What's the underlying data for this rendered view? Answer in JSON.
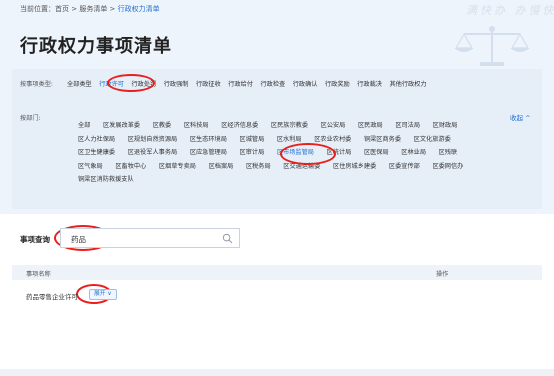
{
  "breadcrumb": {
    "prefix": "当前位置：",
    "home": "首页",
    "sep1": " > ",
    "services": "服务清单",
    "sep2": " > ",
    "current": "行政权力清单"
  },
  "slogan": "满快办 办慢快",
  "page_title": "行政权力事项清单",
  "filters": {
    "type_label": "按事项类型:",
    "types": [
      {
        "label": "全部类型",
        "active": false
      },
      {
        "label": "行政许可",
        "active": true
      },
      {
        "label": "行政处罚",
        "active": false
      },
      {
        "label": "行政强制",
        "active": false
      },
      {
        "label": "行政征收",
        "active": false
      },
      {
        "label": "行政给付",
        "active": false
      },
      {
        "label": "行政检查",
        "active": false
      },
      {
        "label": "行政确认",
        "active": false
      },
      {
        "label": "行政奖励",
        "active": false
      },
      {
        "label": "行政裁决",
        "active": false
      },
      {
        "label": "其他行政权力",
        "active": false
      }
    ],
    "dept_label": "按部门:",
    "collapse_label": "收起 ^",
    "dept_rows": [
      [
        "全部",
        "区发展改革委",
        "区教委",
        "区科技局",
        "区经济信息委",
        "区民族宗教委",
        "区公安局",
        "区民政局",
        "区司法局",
        "区财政局"
      ],
      [
        "区人力社保局",
        "区规划自然资源局",
        "区生态环境局",
        "区城管局",
        "区水利局",
        "区农业农村委",
        "铜梁区商务委",
        "区文化旅游委"
      ],
      [
        "区卫生健康委",
        "区退役军人事务局",
        "区应急管理局",
        "区审计局",
        "区市场监管局",
        "区统计局",
        "区医保局",
        "区林业局",
        "区残联"
      ],
      [
        "区气象局",
        "区畜牧中心",
        "区烟草专卖局",
        "区档案局",
        "区税务局",
        "区交通运输委",
        "区住房城乡建委",
        "区委宣传部",
        "区委网信办"
      ],
      [
        "铜梁区消防救援支队"
      ]
    ],
    "active_dept": "区市场监管局"
  },
  "search": {
    "label": "事项查询",
    "value": "药品",
    "icon": "search-icon"
  },
  "table": {
    "col_name": "事项名称",
    "col_op": "操作",
    "rows": [
      {
        "name": "药品零售企业许可",
        "expand_label": "展开 ∨"
      }
    ]
  },
  "colors": {
    "accent": "#1f6fd1",
    "highlight_ring": "#e8201d",
    "header_bg": "#eef4fb"
  }
}
